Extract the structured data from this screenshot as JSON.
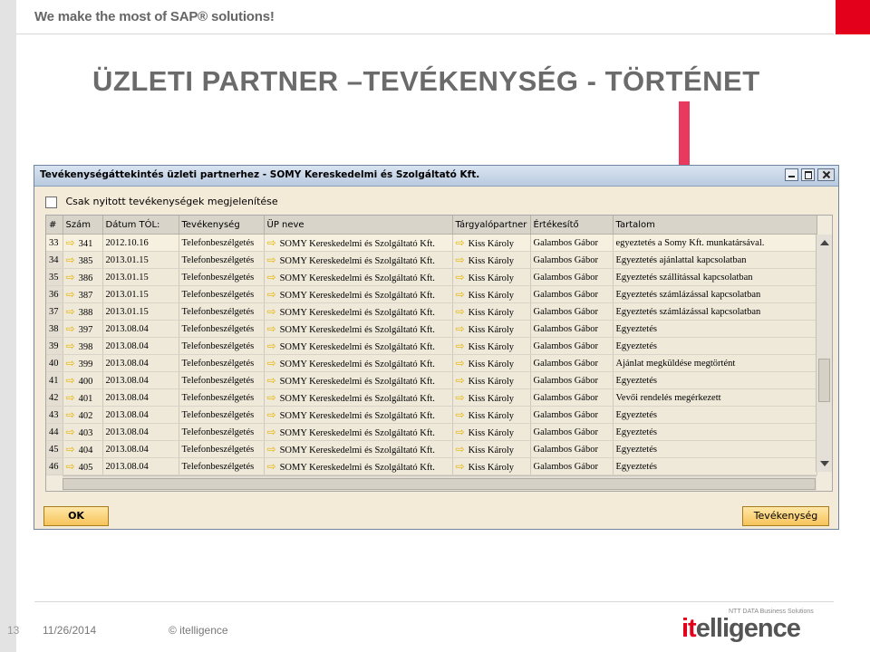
{
  "header": {
    "tagline": "We make the most of SAP® solutions!",
    "title": "ÜZLETI PARTNER –TEVÉKENYSÉG - TÖRTÉNET"
  },
  "window": {
    "title": "Tevékenységáttekintés üzleti partnerhez - SOMY Kereskedelmi és Szolgáltató Kft.",
    "checkbox_label": "Csak nyitott tevékenységek megjelenítése",
    "checkbox_checked": false,
    "columns": [
      "#",
      "Szám",
      "Dátum TÓL:",
      "Tevékenység",
      "ÜP neve",
      "Tárgyalópartner",
      "Értékesítő",
      "Tartalom"
    ],
    "rows": [
      {
        "n": "33",
        "szam": "341",
        "datum": "2012.10.16",
        "tev": "Telefonbeszélgetés",
        "up": "SOMY Kereskedelmi és Szolgáltató Kft.",
        "partner": "Kiss Károly",
        "ert": "Galambos Gábor",
        "tartalom": "egyeztetés a Somy Kft. munkatársával."
      },
      {
        "n": "34",
        "szam": "385",
        "datum": "2013.01.15",
        "tev": "Telefonbeszélgetés",
        "up": "SOMY Kereskedelmi és Szolgáltató Kft.",
        "partner": "Kiss Károly",
        "ert": "Galambos Gábor",
        "tartalom": "Egyeztetés ajánlattal kapcsolatban"
      },
      {
        "n": "35",
        "szam": "386",
        "datum": "2013.01.15",
        "tev": "Telefonbeszélgetés",
        "up": "SOMY Kereskedelmi és Szolgáltató Kft.",
        "partner": "Kiss Károly",
        "ert": "Galambos Gábor",
        "tartalom": "Egyeztetés szállítással kapcsolatban"
      },
      {
        "n": "36",
        "szam": "387",
        "datum": "2013.01.15",
        "tev": "Telefonbeszélgetés",
        "up": "SOMY Kereskedelmi és Szolgáltató Kft.",
        "partner": "Kiss Károly",
        "ert": "Galambos Gábor",
        "tartalom": "Egyeztetés számlázással kapcsolatban"
      },
      {
        "n": "37",
        "szam": "388",
        "datum": "2013.01.15",
        "tev": "Telefonbeszélgetés",
        "up": "SOMY Kereskedelmi és Szolgáltató Kft.",
        "partner": "Kiss Károly",
        "ert": "Galambos Gábor",
        "tartalom": "Egyeztetés számlázással kapcsolatban"
      },
      {
        "n": "38",
        "szam": "397",
        "datum": "2013.08.04",
        "tev": "Telefonbeszélgetés",
        "up": "SOMY Kereskedelmi és Szolgáltató Kft.",
        "partner": "Kiss Károly",
        "ert": "Galambos Gábor",
        "tartalom": "Egyeztetés"
      },
      {
        "n": "39",
        "szam": "398",
        "datum": "2013.08.04",
        "tev": "Telefonbeszélgetés",
        "up": "SOMY Kereskedelmi és Szolgáltató Kft.",
        "partner": "Kiss Károly",
        "ert": "Galambos Gábor",
        "tartalom": "Egyeztetés"
      },
      {
        "n": "40",
        "szam": "399",
        "datum": "2013.08.04",
        "tev": "Telefonbeszélgetés",
        "up": "SOMY Kereskedelmi és Szolgáltató Kft.",
        "partner": "Kiss Károly",
        "ert": "Galambos Gábor",
        "tartalom": "Ajánlat megküldése megtörtént"
      },
      {
        "n": "41",
        "szam": "400",
        "datum": "2013.08.04",
        "tev": "Telefonbeszélgetés",
        "up": "SOMY Kereskedelmi és Szolgáltató Kft.",
        "partner": "Kiss Károly",
        "ert": "Galambos Gábor",
        "tartalom": "Egyeztetés"
      },
      {
        "n": "42",
        "szam": "401",
        "datum": "2013.08.04",
        "tev": "Telefonbeszélgetés",
        "up": "SOMY Kereskedelmi és Szolgáltató Kft.",
        "partner": "Kiss Károly",
        "ert": "Galambos Gábor",
        "tartalom": "Vevői rendelés megérkezett"
      },
      {
        "n": "43",
        "szam": "402",
        "datum": "2013.08.04",
        "tev": "Telefonbeszélgetés",
        "up": "SOMY Kereskedelmi és Szolgáltató Kft.",
        "partner": "Kiss Károly",
        "ert": "Galambos Gábor",
        "tartalom": "Egyeztetés"
      },
      {
        "n": "44",
        "szam": "403",
        "datum": "2013.08.04",
        "tev": "Telefonbeszélgetés",
        "up": "SOMY Kereskedelmi és Szolgáltató Kft.",
        "partner": "Kiss Károly",
        "ert": "Galambos Gábor",
        "tartalom": "Egyeztetés"
      },
      {
        "n": "45",
        "szam": "404",
        "datum": "2013.08.04",
        "tev": "Telefonbeszélgetés",
        "up": "SOMY Kereskedelmi és Szolgáltató Kft.",
        "partner": "Kiss Károly",
        "ert": "Galambos Gábor",
        "tartalom": "Egyeztetés"
      },
      {
        "n": "46",
        "szam": "405",
        "datum": "2013.08.04",
        "tev": "Telefonbeszélgetés",
        "up": "SOMY Kereskedelmi és Szolgáltató Kft.",
        "partner": "Kiss Károly",
        "ert": "Galambos Gábor",
        "tartalom": "Egyeztetés"
      }
    ],
    "ok_label": "OK",
    "activity_label": "Tevékenység"
  },
  "footer": {
    "slide_number": "13",
    "date": "11/26/2014",
    "copyright": "© itelligence",
    "logo_text_prefix": "it",
    "logo_text_rest": "elligence",
    "logo_subtitle": "NTT DATA Business Solutions"
  },
  "colors": {
    "brand_red": "#e2001a",
    "arrow_pink": "#e8395e",
    "button_yellow": "#f7c35a"
  },
  "icons": [
    "link-arrow-icon",
    "checkbox-icon",
    "minimize-icon",
    "maximize-icon",
    "close-icon",
    "scroll-up-icon",
    "scroll-down-icon"
  ]
}
